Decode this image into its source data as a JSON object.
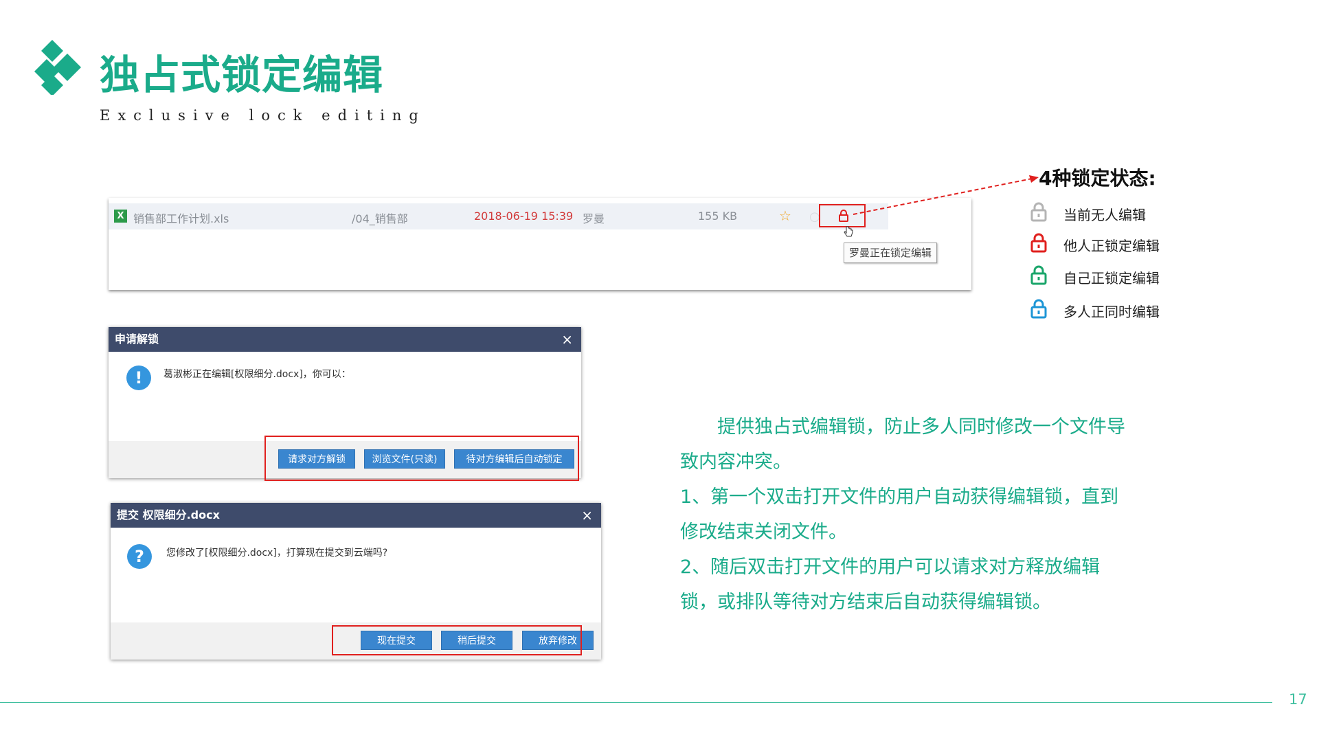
{
  "header": {
    "title": "独占式锁定编辑",
    "subtitle": "Exclusive lock editing",
    "accent_color": "#1aab8a"
  },
  "file_row": {
    "icon": "xls-file-icon",
    "filename": "销售部工作计划.xls",
    "path": "/04_销售部",
    "datetime": "2018-06-19 15:39",
    "user": "罗曼",
    "size": "155 KB",
    "tooltip": "罗曼正在锁定编辑"
  },
  "dialog_unlock": {
    "title": "申请解锁",
    "close": "×",
    "message": "葛淑彬正在编辑[权限细分.docx]，你可以：",
    "icon": "!",
    "buttons": [
      "请求对方解锁",
      "浏览文件(只读)",
      "待对方编辑后自动锁定"
    ]
  },
  "dialog_submit": {
    "title": "提交 权限细分.docx",
    "close": "×",
    "message": "您修改了[权限细分.docx]，打算现在提交到云端吗?",
    "icon": "?",
    "buttons": [
      "现在提交",
      "稍后提交",
      "放弃修改"
    ]
  },
  "legend": {
    "title": "4种锁定状态:",
    "items": [
      {
        "label": "当前无人编辑",
        "color": "#b4b4b4",
        "icon": "lock-gray-icon"
      },
      {
        "label": "他人正锁定编辑",
        "color": "#e0201e",
        "icon": "lock-red-icon"
      },
      {
        "label": "自己正锁定编辑",
        "color": "#1aa56a",
        "icon": "lock-green-icon"
      },
      {
        "label": "多人正同时编辑",
        "color": "#1e96d6",
        "icon": "lock-blue-icon"
      }
    ]
  },
  "description": [
    "　　提供独占式编辑锁，防止多人同时修改一个文件导致内容冲突。",
    "1、第一个双击打开文件的用户自动获得编辑锁，直到修改结束关闭文件。",
    "2、随后双击打开文件的用户可以请求对方释放编辑锁，或排队等待对方结束后自动获得编辑锁。"
  ],
  "page_number": "17"
}
